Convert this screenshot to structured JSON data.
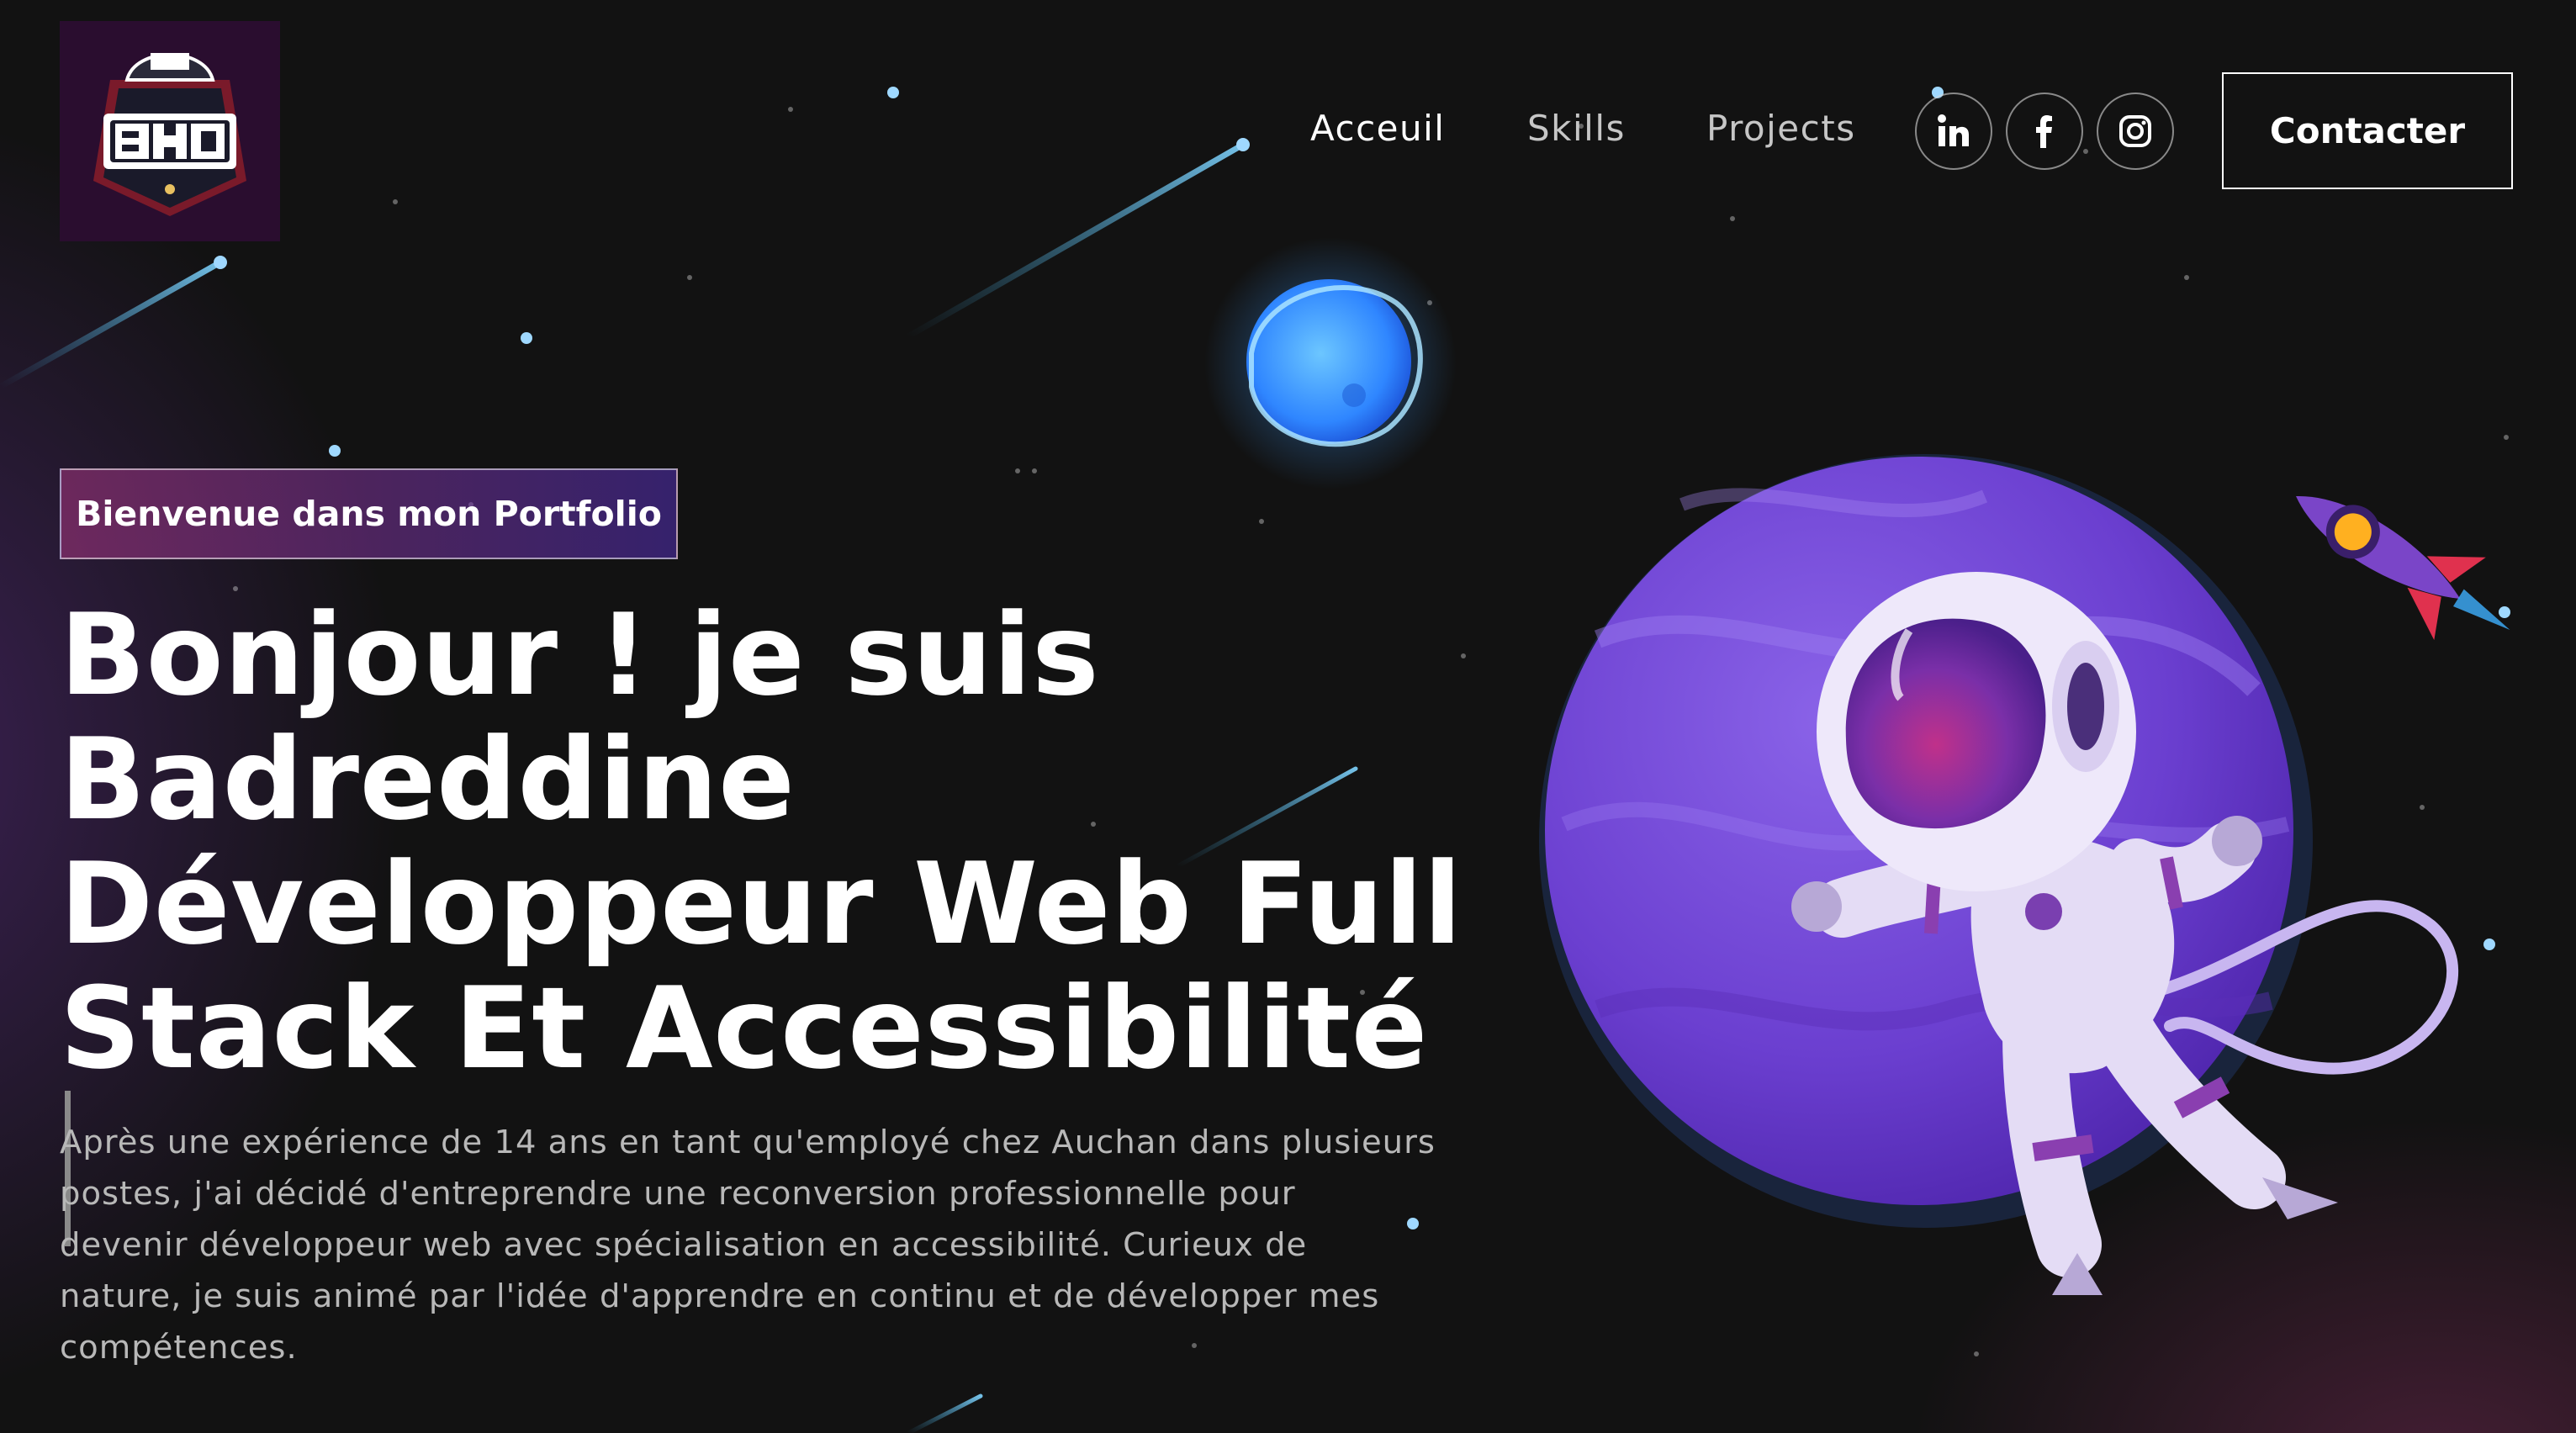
{
  "logo": {
    "alt_text": "BHD",
    "icon": "bhd-cap-logo"
  },
  "nav": {
    "links": [
      "Acceuil",
      "Skills",
      "Projects"
    ],
    "socials": [
      {
        "name": "LinkedIn",
        "icon": "linkedin-icon"
      },
      {
        "name": "Facebook",
        "icon": "facebook-icon"
      },
      {
        "name": "Instagram",
        "icon": "instagram-icon"
      }
    ],
    "contact_label": "Contacter"
  },
  "hero": {
    "tagline": "Bienvenue dans mon Portfolio",
    "title_lines": [
      "Bonjour ! je suis",
      "Badreddine",
      "Développeur Web Full",
      "Stack Et Accessibilité"
    ],
    "intro_lines": [
      "Après une expérience de 14 ans en tant qu'employé chez Auchan dans plusieurs",
      "postes, j'ai décidé d'entreprendre une reconversion professionnelle pour",
      "devenir développeur web avec spécialisation en accessibilité. Curieux de",
      "nature, je suis animé par l'idée d'apprendre en continu et de développer mes",
      "compétences."
    ]
  },
  "colors": {
    "background": "#121212",
    "tagline_gradient_start": "#aa367c",
    "tagline_gradient_end": "#4a2fbd",
    "planet": "#6b3fd0",
    "accent_blue": "#4aa8ff"
  }
}
